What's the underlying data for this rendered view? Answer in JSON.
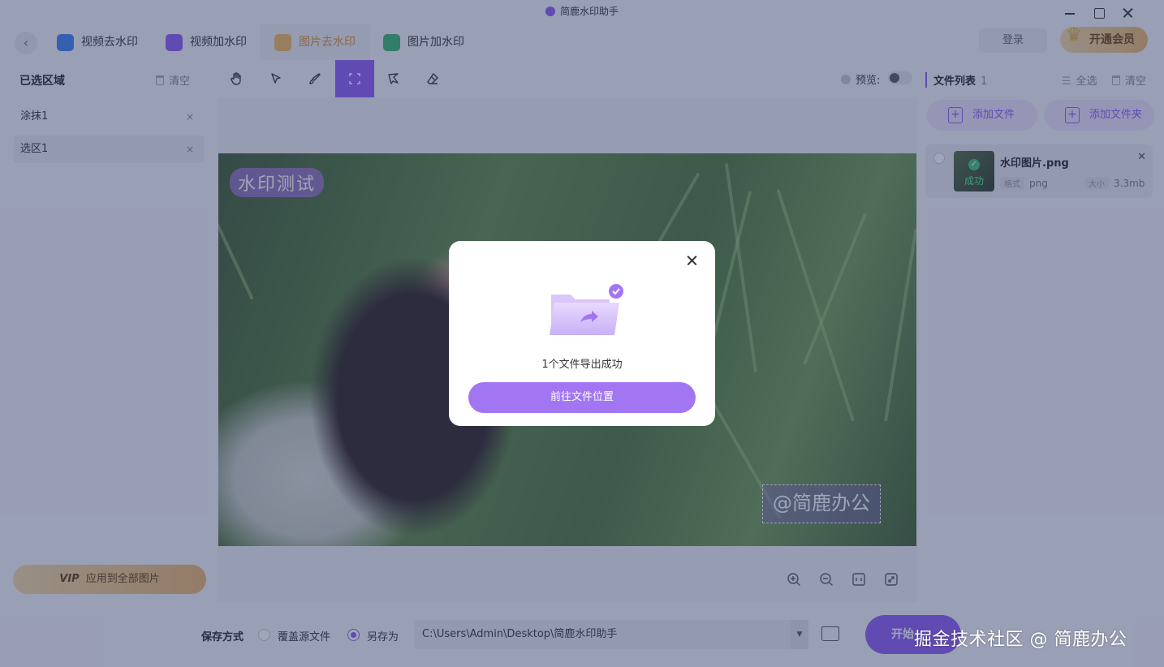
{
  "window": {
    "title": "简鹿水印助手",
    "controls": [
      "minimize-icon",
      "maximize-icon",
      "close-icon"
    ]
  },
  "nav": {
    "back_icon": "chevron-left-icon",
    "tabs": [
      {
        "label": "视频去水印",
        "icon": "video-remove-icon",
        "active": false
      },
      {
        "label": "视频加水印",
        "icon": "video-add-icon",
        "active": false
      },
      {
        "label": "图片去水印",
        "icon": "image-remove-icon",
        "active": true
      },
      {
        "label": "图片加水印",
        "icon": "image-add-icon",
        "active": false
      }
    ],
    "login_label": "登录",
    "vip_label": "开通会员",
    "vip_badge": "VIP"
  },
  "left_panel": {
    "title": "已选区域",
    "clear_label": "清空",
    "regions": [
      {
        "label": "涂抹1",
        "selected": false
      },
      {
        "label": "选区1",
        "selected": true
      }
    ],
    "apply_vip": "VIP",
    "apply_label": "应用到全部图片"
  },
  "toolbar": {
    "tools": [
      "hand-icon",
      "pointer-icon",
      "brush-icon",
      "rect-select-icon",
      "lasso-icon",
      "eraser-icon"
    ],
    "active_tool": "rect-select-icon",
    "preview_label": "预览:",
    "preview_on": false
  },
  "canvas": {
    "watermark_top": "水印测试",
    "watermark_bottom": "@简鹿办公",
    "zoom_tools": [
      "zoom-in-icon",
      "zoom-out-icon",
      "fit-icon",
      "fullscreen-icon"
    ]
  },
  "right_panel": {
    "title": "文件列表",
    "count": "1",
    "select_all": "全选",
    "clear_label": "清空",
    "add_file": "添加文件",
    "add_folder": "添加文件夹",
    "files": [
      {
        "name": "水印图片.png",
        "status": "成功",
        "format_tag": "格式",
        "format": "png",
        "size_tag": "大小",
        "size": "3.3mb"
      }
    ]
  },
  "bottom": {
    "save_label": "保存方式",
    "option_overwrite": "覆盖源文件",
    "option_saveas": "另存为",
    "selected_option": "另存为",
    "path": "C:\\Users\\Admin\\Desktop\\简鹿水印助手",
    "start_label": "开始"
  },
  "modal": {
    "message": "1个文件导出成功",
    "button": "前往文件位置",
    "icon": "folder-success-icon"
  },
  "footer_credit": "掘金技术社区 @ 简鹿办公",
  "colors": {
    "accent": "#8b5cf6",
    "active_tab": "#d8912e",
    "success": "#3dc27a",
    "vip_gold": "#e9b56b",
    "overlay": "rgba(46,56,98,0.46)"
  }
}
